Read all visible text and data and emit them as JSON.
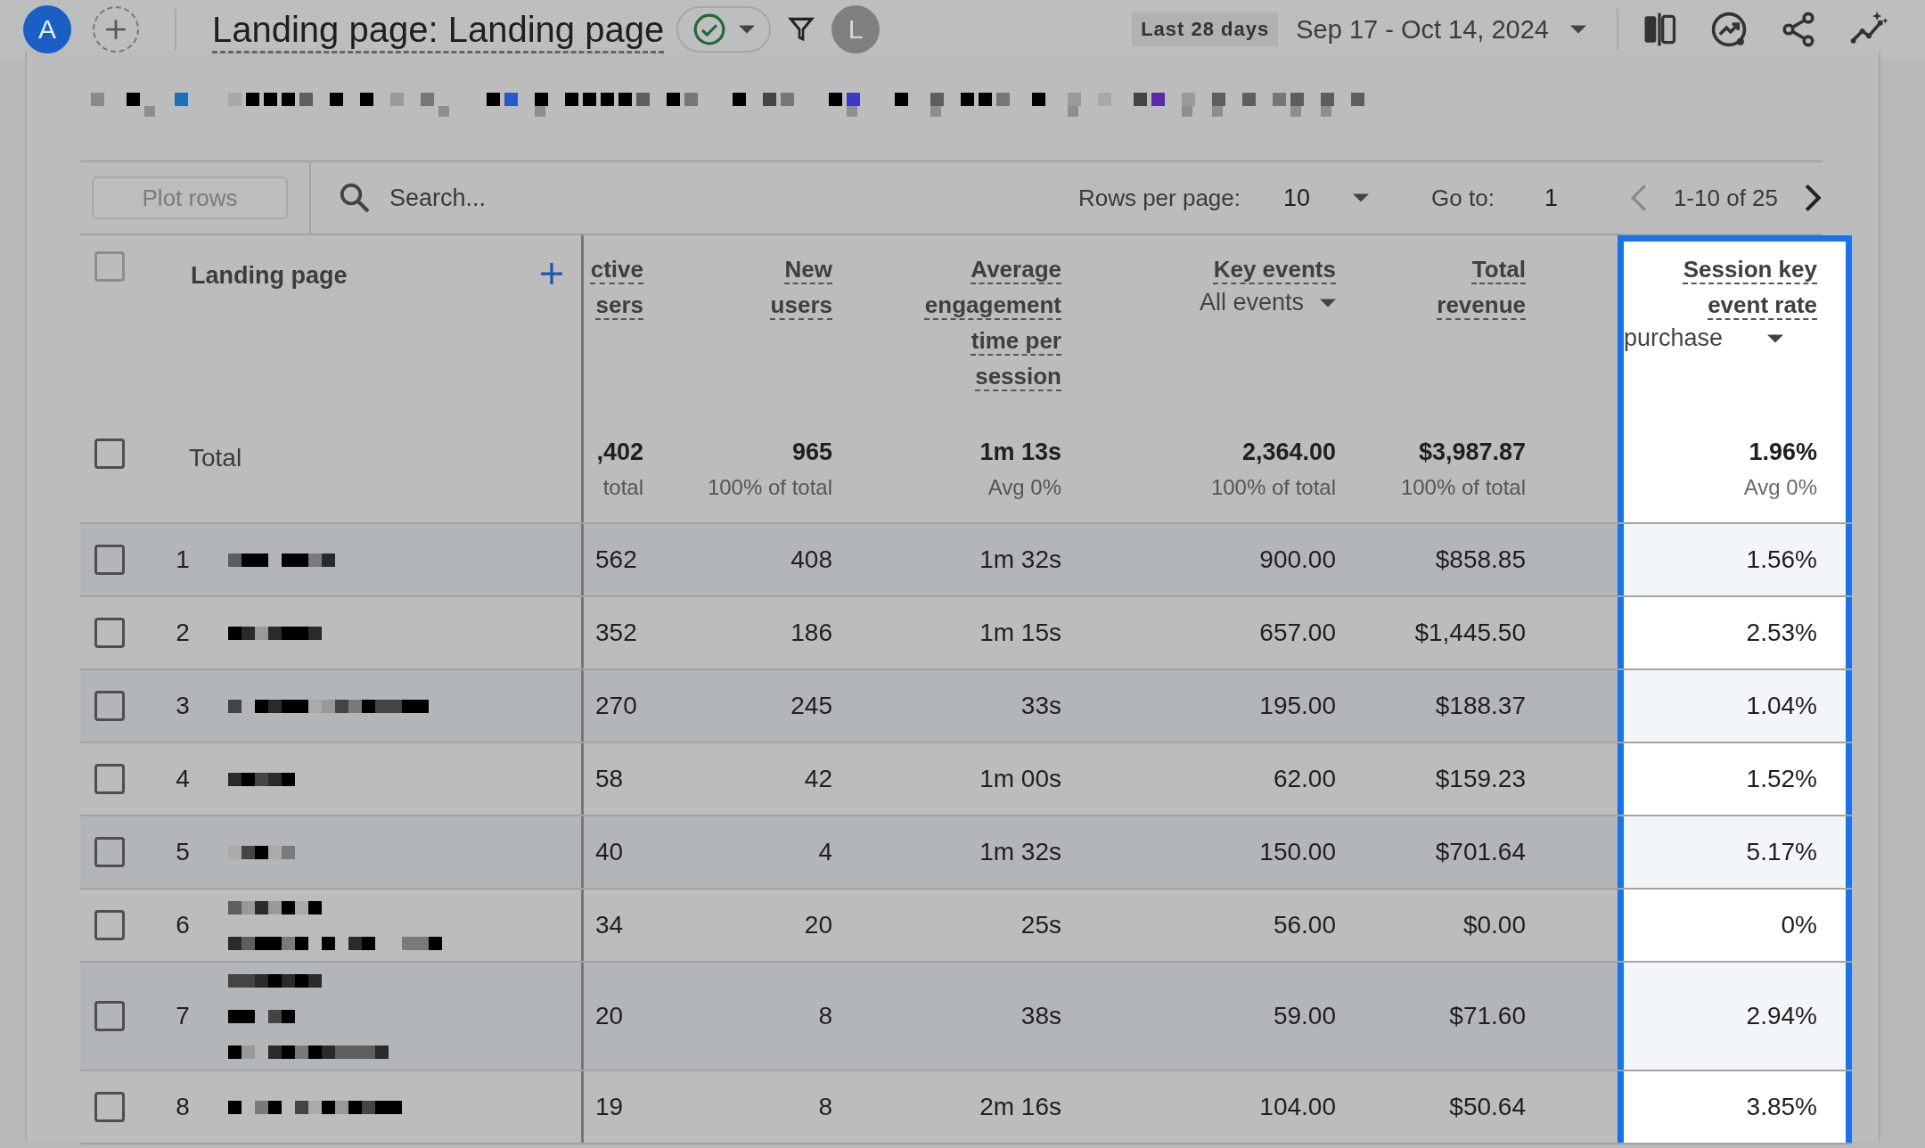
{
  "top_bar": {
    "account_initial": "A",
    "title": "Landing page: Landing page",
    "user_initial": "L",
    "date_preset": "Last 28 days",
    "date_range": "Sep 17 - Oct 14, 2024"
  },
  "toolbar": {
    "plot_rows": {
      "label": "Plot rows",
      "disabled": true
    },
    "search": {
      "placeholder": "Search..."
    },
    "rows_per_page_label": "Rows per page:",
    "rows_per_page": "10",
    "go_to_label": "Go to:",
    "go_to": "1",
    "range": "1-10 of 25",
    "prev_disabled": true
  },
  "table": {
    "select_all": {
      "checked": false,
      "disabled": true
    },
    "dimension": "Landing page",
    "columns": [
      {
        "label": "ctive sers"
      },
      {
        "label": "New users"
      },
      {
        "label": "Average engagement time per session"
      },
      {
        "label": "Key events",
        "filter": "All events"
      },
      {
        "label": "Total revenue"
      },
      {
        "label": "Session key event rate",
        "filter": "purchase",
        "highlighted": true
      }
    ],
    "total": {
      "label": "Total",
      "checked": false,
      "cells": [
        {
          "value": ",402",
          "note": "total"
        },
        {
          "value": "965",
          "note": "100% of total"
        },
        {
          "value": "1m 13s",
          "note": "Avg 0%"
        },
        {
          "value": "2,364.00",
          "note": "100% of total"
        },
        {
          "value": "$3,987.87",
          "note": "100% of total"
        },
        {
          "value": "1.96%",
          "note": "Avg 0%"
        }
      ]
    },
    "rows": [
      {
        "index": "1",
        "checked": false,
        "cells": [
          "562",
          "408",
          "1m 32s",
          "900.00",
          "$858.85",
          "1.56%"
        ]
      },
      {
        "index": "2",
        "checked": false,
        "cells": [
          "352",
          "186",
          "1m 15s",
          "657.00",
          "$1,445.50",
          "2.53%"
        ]
      },
      {
        "index": "3",
        "checked": false,
        "cells": [
          "270",
          "245",
          "33s",
          "195.00",
          "$188.37",
          "1.04%"
        ]
      },
      {
        "index": "4",
        "checked": false,
        "cells": [
          "58",
          "42",
          "1m 00s",
          "62.00",
          "$159.23",
          "1.52%"
        ]
      },
      {
        "index": "5",
        "checked": false,
        "cells": [
          "40",
          "4",
          "1m 32s",
          "150.00",
          "$701.64",
          "5.17%"
        ]
      },
      {
        "index": "6",
        "checked": false,
        "cells": [
          "34",
          "20",
          "25s",
          "56.00",
          "$0.00",
          "0%"
        ]
      },
      {
        "index": "7",
        "checked": false,
        "cells": [
          "20",
          "8",
          "38s",
          "59.00",
          "$71.60",
          "2.94%"
        ]
      },
      {
        "index": "8",
        "checked": false,
        "cells": [
          "19",
          "8",
          "2m 16s",
          "104.00",
          "$50.64",
          "3.85%"
        ]
      }
    ]
  }
}
